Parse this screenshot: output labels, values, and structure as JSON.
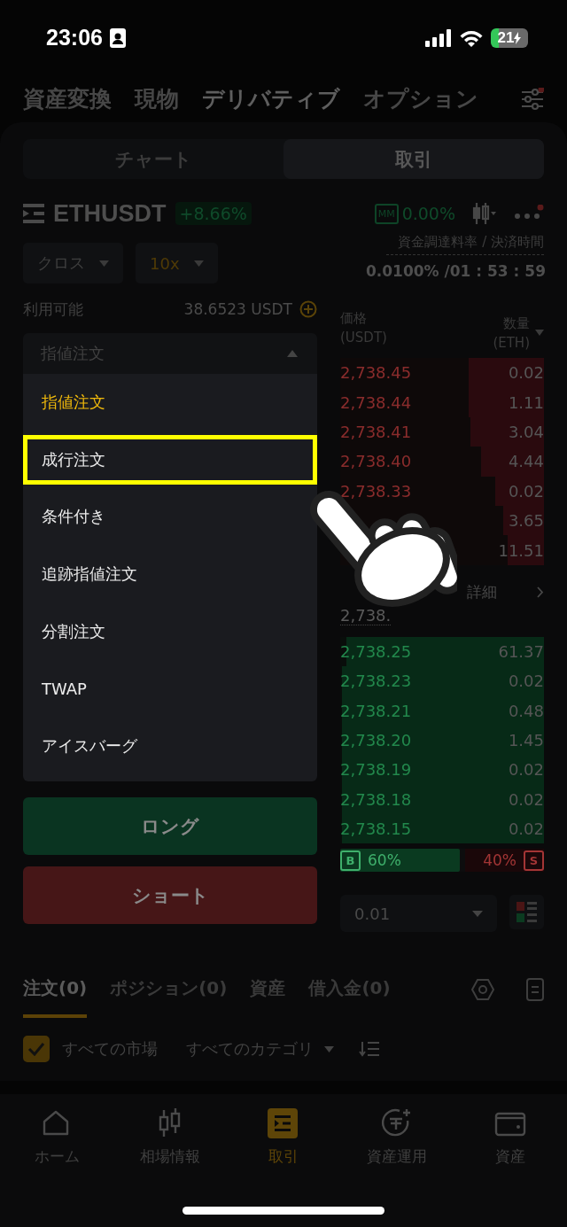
{
  "status_bar": {
    "time": "23:06",
    "battery": "21"
  },
  "top_tabs": [
    {
      "label": "資産変換",
      "selected": false
    },
    {
      "label": "現物",
      "selected": false
    },
    {
      "label": "デリバティブ",
      "selected": true
    },
    {
      "label": "オプション",
      "selected": false
    }
  ],
  "view_tabs": [
    {
      "label": "チャート",
      "selected": false
    },
    {
      "label": "取引",
      "selected": true
    }
  ],
  "symbol": {
    "name": "ETHUSDT",
    "change": "+8.66%",
    "mm_label": "MM",
    "mm_value": "0.00%"
  },
  "margin_mode": "クロス",
  "leverage": "10x",
  "funding": {
    "label": "資金調達料率 / 決済時間",
    "value": "0.0100% /01 : 53 : 59"
  },
  "available": {
    "label": "利用可能",
    "value": "38.6523 USDT"
  },
  "order_type": {
    "value": "指値注文",
    "options": [
      {
        "label": "指値注文",
        "selected": true,
        "highlighted": false
      },
      {
        "label": "成行注文",
        "selected": false,
        "highlighted": true
      },
      {
        "label": "条件付き",
        "selected": false,
        "highlighted": false
      },
      {
        "label": "追跡指値注文",
        "selected": false,
        "highlighted": false
      },
      {
        "label": "分割注文",
        "selected": false,
        "highlighted": false
      },
      {
        "label": "TWAP",
        "selected": false,
        "highlighted": false
      },
      {
        "label": "アイスバーグ",
        "selected": false,
        "highlighted": false
      }
    ]
  },
  "buttons": [
    {
      "label": "ロング",
      "kind": "long"
    },
    {
      "label": "ショート",
      "kind": "short"
    }
  ],
  "order_book": {
    "price_header": "価格",
    "price_unit": "(USDT)",
    "qty_header": "数量",
    "qty_unit": "(ETH)",
    "asks": [
      {
        "price": "2,738.45",
        "qty": "0.02",
        "level": 0.37
      },
      {
        "price": "2,738.44",
        "qty": "1.11",
        "level": 0.37
      },
      {
        "price": "2,738.41",
        "qty": "3.04",
        "level": 0.36
      },
      {
        "price": "2,738.40",
        "qty": "4.44",
        "level": 0.31
      },
      {
        "price": "2,738.33",
        "qty": "0.02",
        "level": 0.24
      },
      {
        "qty": "3.65",
        "level": 0.2
      },
      {
        "qty": "11.51",
        "level": 0.18
      }
    ],
    "mid_price": "2,738.",
    "detail": "詳細",
    "bids": [
      {
        "price": "2,738.25",
        "qty": "61.37",
        "level": 0.97
      },
      {
        "price": "2,738.23",
        "qty": "0.02",
        "level": 0.99
      },
      {
        "price": "2,738.21",
        "qty": "0.48",
        "level": 0.99
      },
      {
        "price": "2,738.20",
        "qty": "1.45",
        "level": 0.99
      },
      {
        "price": "2,738.19",
        "qty": "0.02",
        "level": 0.99
      },
      {
        "price": "2,738.18",
        "qty": "0.02",
        "level": 0.99
      },
      {
        "price": "2,738.15",
        "qty": "0.02",
        "level": 0.99
      }
    ],
    "ratio": {
      "buy_label": "B",
      "buy": "60%",
      "sell": "40%",
      "sell_label": "S",
      "level": 0.6
    },
    "precision": "0.01"
  },
  "bottom_tabs": [
    {
      "label": "注文(0)",
      "selected": true
    },
    {
      "label": "ポジション(0)",
      "selected": false
    },
    {
      "label": "資産",
      "selected": false
    },
    {
      "label": "借入金(0)",
      "selected": false
    }
  ],
  "filters": {
    "all_markets": {
      "label": "すべての市場",
      "checked": true
    },
    "category": "すべてのカテゴリ"
  },
  "nav": [
    {
      "label": "ホーム",
      "kind": "home",
      "selected": false
    },
    {
      "label": "相場情報",
      "kind": "markets",
      "selected": false
    },
    {
      "label": "取引",
      "kind": "trade",
      "selected": true
    },
    {
      "label": "資産運用",
      "kind": "earn",
      "selected": false
    },
    {
      "label": "資産",
      "kind": "assets",
      "selected": false
    }
  ]
}
